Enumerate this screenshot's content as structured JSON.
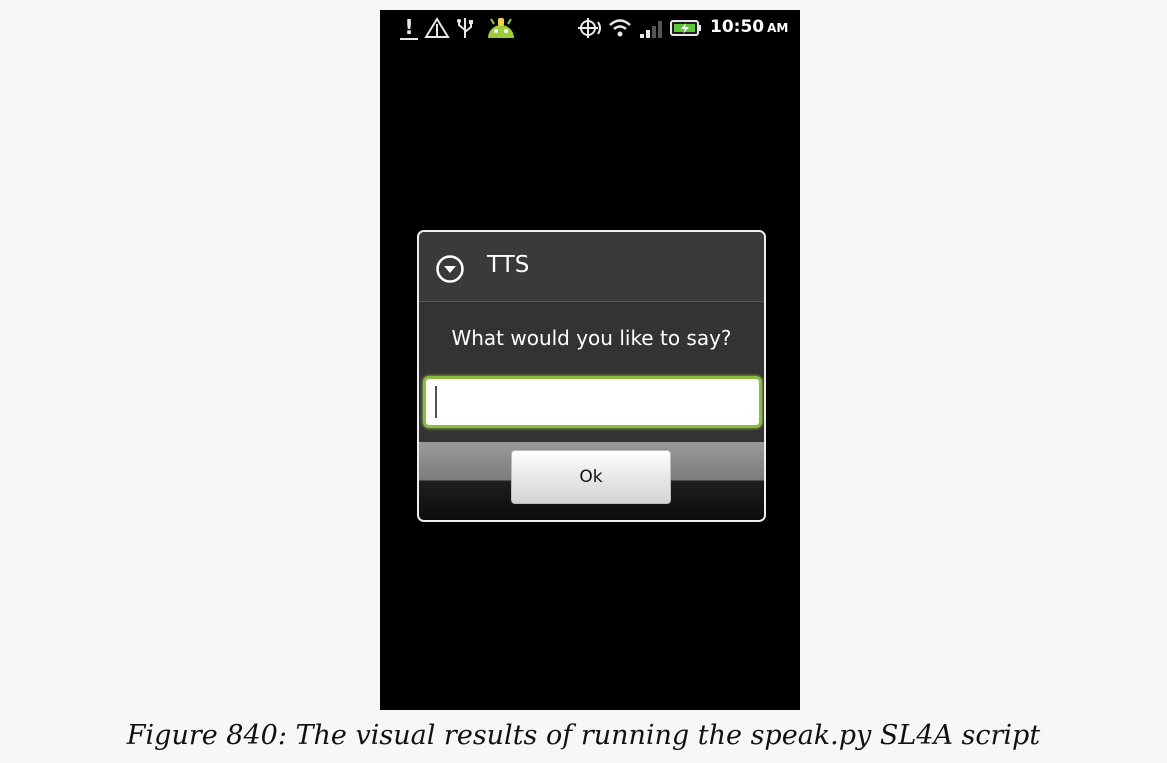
{
  "status_bar": {
    "icons": [
      "alert-icon",
      "warning-triangle-icon",
      "usb-icon",
      "android-debug-icon",
      "gps-icon",
      "wifi-icon",
      "signal-icon",
      "battery-charging-icon"
    ],
    "time": "10:50",
    "ampm": "AM"
  },
  "dialog": {
    "icon": "chevron-down-circle-icon",
    "title": "TTS",
    "message": "What would you like to say?",
    "input_value": "",
    "ok_label": "Ok"
  },
  "caption": "Figure 840: The visual results of running the speak.py SL4A script",
  "colors": {
    "page_background": "#f7f7f7",
    "screen_background": "#000000",
    "dialog_background": "#333333",
    "input_focus_border": "#8bbd3c"
  }
}
